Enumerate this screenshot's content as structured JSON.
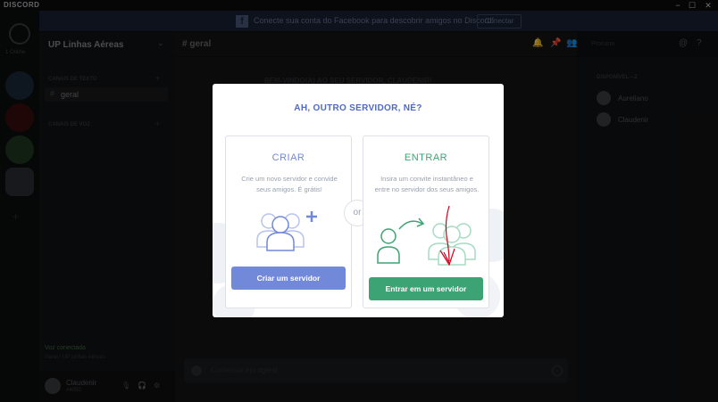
{
  "window": {
    "brand": "DISCORD",
    "minimize": "−",
    "maximize": "☐",
    "close": "✕"
  },
  "banner": {
    "text": "Conecte sua conta do Facebook para descobrir amigos no Discord!",
    "button": "Conectar",
    "icon": "facebook-icon"
  },
  "servers": {
    "online_text": "1 Online"
  },
  "channels": {
    "server_name": "UP Linhas Aéreas",
    "text_category": "CANAIS DE TEXTO",
    "voice_category": "CANAIS DE VOZ",
    "active_channel": "geral"
  },
  "voice_status": {
    "label": "Voz conectada",
    "sub": "Geral / UP Linhas Aéreas"
  },
  "user": {
    "name": "Claudenir",
    "tag": "#4050"
  },
  "chat": {
    "title": "# geral",
    "welcome": "BEM-VINDO(A) AO SEU SERVIDOR, CLAUDENIR!",
    "placeholder": "Conversar em #geral",
    "search_placeholder": "Procurar"
  },
  "members": {
    "category": "DISPONÍVEL—2",
    "list": [
      {
        "name": "Aureliano"
      },
      {
        "name": "Claudenir"
      }
    ]
  },
  "modal": {
    "title": "AH, OUTRO SERVIDOR, NÉ?",
    "or": "or",
    "create": {
      "title": "CRIAR",
      "desc": "Crie um novo servidor e convide seus amigos. É grátis!",
      "button": "Criar um servidor",
      "color": "#7289da"
    },
    "join": {
      "title": "ENTRAR",
      "desc": "Insira um convite instantâneo e entre no servidor dos seus amigos.",
      "button": "Entrar em um servidor",
      "color": "#3ca374"
    }
  }
}
